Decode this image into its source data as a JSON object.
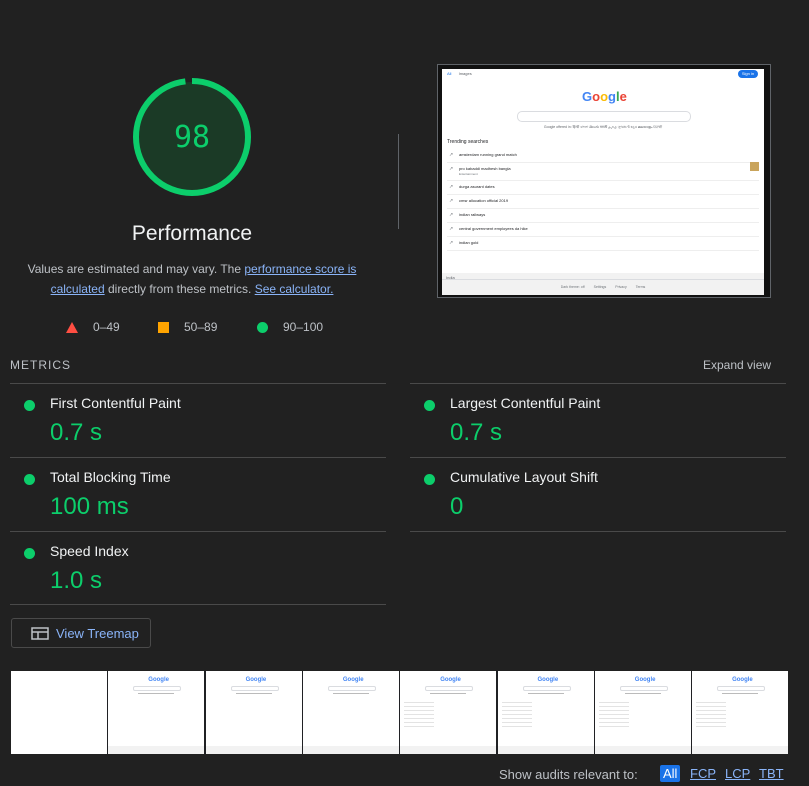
{
  "score": {
    "value": "98",
    "fraction": 0.98,
    "color": "#0cce6b"
  },
  "category": {
    "title": "Performance"
  },
  "description": {
    "prefix": "Values are estimated and may vary. The ",
    "link1": "performance score is calculated",
    "middle": " directly from these metrics. ",
    "link2": "See calculator."
  },
  "legend": [
    {
      "shape": "triangle",
      "label": "0–49",
      "color": "#ff4e42"
    },
    {
      "shape": "square",
      "label": "50–89",
      "color": "#ffa400"
    },
    {
      "shape": "circle",
      "label": "90–100",
      "color": "#0cce6b"
    }
  ],
  "metrics_header": {
    "label": "METRICS",
    "expand": "Expand view"
  },
  "metrics": [
    {
      "name": "First Contentful Paint",
      "value": "0.7 s"
    },
    {
      "name": "Largest Contentful Paint",
      "value": "0.7 s"
    },
    {
      "name": "Total Blocking Time",
      "value": "100 ms"
    },
    {
      "name": "Cumulative Layout Shift",
      "value": "0"
    },
    {
      "name": "Speed Index",
      "value": "1.0 s"
    }
  ],
  "treemap_button": {
    "label": "View Treemap"
  },
  "preview": {
    "nav": [
      "All",
      "Images"
    ],
    "sign_in": "Sign in",
    "offered_in": "Google offered in: हिन्दी বাংলা తెలుగు मराठी தமிழ் ગુજરાતી ಕನ್ನಡ മലയാളം ਪੰਜਾਬੀ",
    "trending_title": "Trending searches",
    "trending": [
      "amsterdam running grand match",
      "pro kabaddi madhesh bangla",
      "durga asurant dates",
      "cmsr allocation official 2019",
      "indian railways",
      "central government employees da hike",
      "indian gold"
    ],
    "trending_sub": "Entertainment",
    "country": "India",
    "footer": [
      "Dark theme: off",
      "Settings",
      "Privacy",
      "Terms"
    ]
  },
  "filmstrip": {
    "frames": 8
  },
  "audits_filter": {
    "label": "Show audits relevant to:",
    "chips": [
      "All",
      "FCP",
      "LCP",
      "TBT"
    ]
  }
}
